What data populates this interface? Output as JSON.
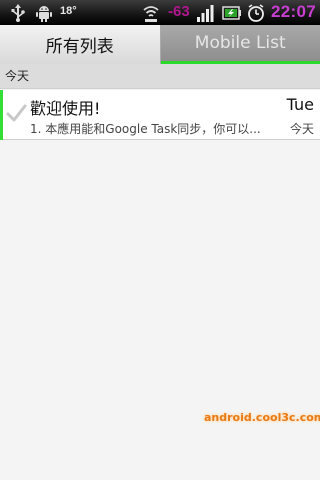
{
  "statusbar": {
    "temperature": "18°",
    "signal_strength": "-63",
    "time": "22:07",
    "icons": [
      "usb-icon",
      "android-icon",
      "wifi-icon",
      "signal-bars-icon",
      "battery-charging-icon",
      "alarm-clock-icon"
    ]
  },
  "tabs": [
    {
      "label": "所有列表",
      "active": true
    },
    {
      "label": "Mobile List",
      "active": false
    }
  ],
  "section": {
    "title": "今天"
  },
  "tasks": [
    {
      "title": "歡迎使用!",
      "subtitle": "1. 本應用能和Google Task同步，你可以...",
      "day": "Tue",
      "date": "今天",
      "accent_color": "#33dd33"
    }
  ],
  "watermark": "android.cool3c.com",
  "colors": {
    "clock": "#c63fd0",
    "signal": "#b0168c",
    "tab_indicator": "#2bd92b"
  }
}
